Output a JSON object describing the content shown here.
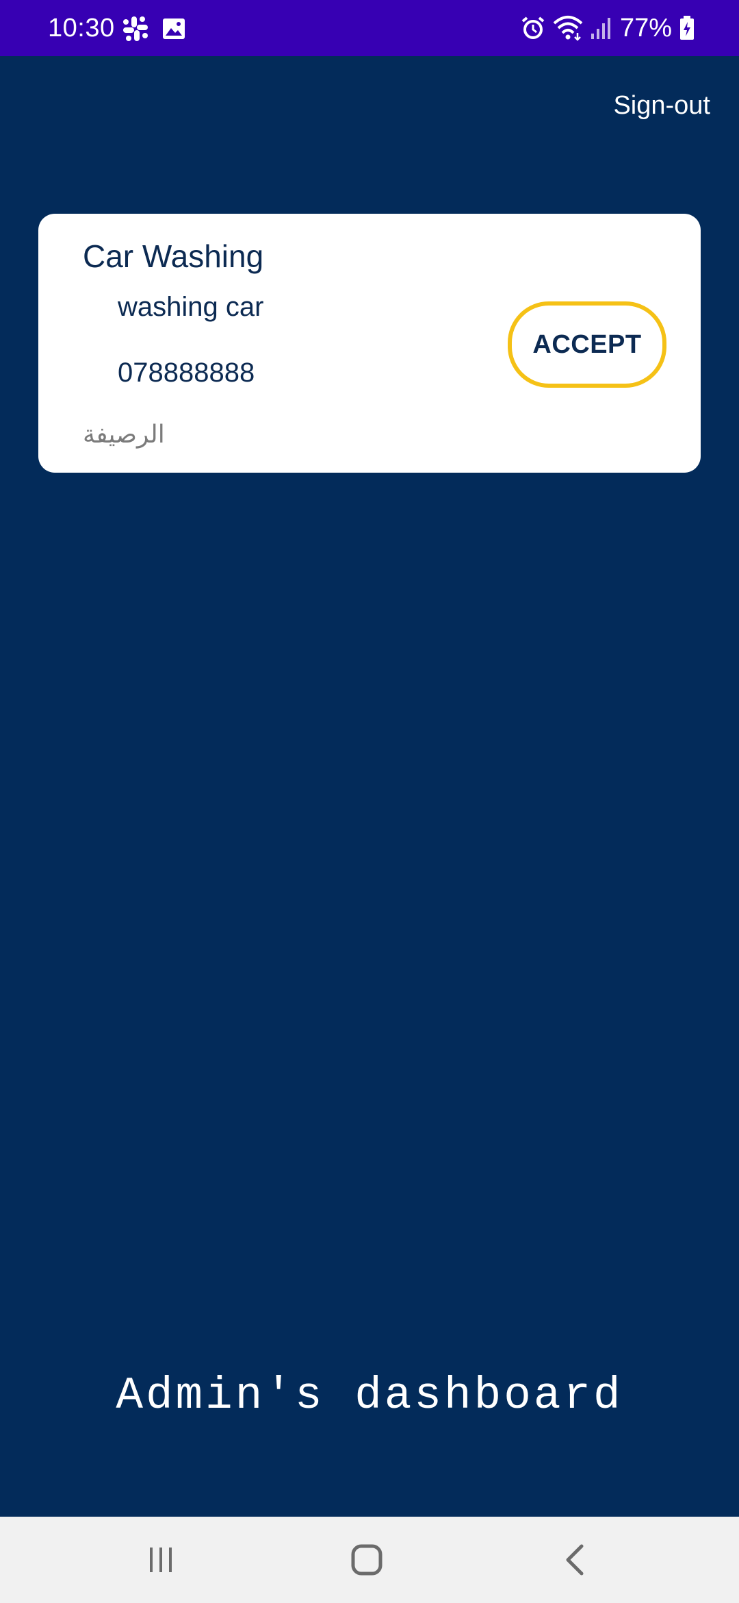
{
  "status_bar": {
    "time": "10:30",
    "battery_percent": "77%",
    "left_icons": [
      "slack-icon",
      "image-icon"
    ],
    "right_icons": [
      "alarm-icon",
      "wifi-icon",
      "signal-icon",
      "battery-charging-icon"
    ]
  },
  "header": {
    "signout_label": "Sign-out"
  },
  "request_card": {
    "title": "Car Washing",
    "description": "washing car",
    "phone": "078888888",
    "location": "الرصيفة",
    "accept_label": "ACCEPT"
  },
  "footer": {
    "title": "Admin's dashboard"
  },
  "nav_bar": {
    "buttons": [
      "recent-apps-icon",
      "home-icon",
      "back-icon"
    ]
  },
  "colors": {
    "status_bar": "#3700b3",
    "background": "#032b5a",
    "card": "#ffffff",
    "accent_border": "#f5c116",
    "primary_text": "#0c2a52",
    "secondary_text": "#7b7b7b",
    "nav_bar": "#f1f1f1"
  }
}
